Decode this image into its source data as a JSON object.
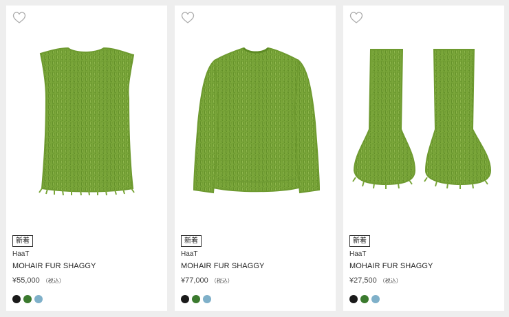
{
  "products": [
    {
      "badge": "新着",
      "brand": "HaaT",
      "name": "MOHAIR FUR SHAGGY",
      "price": "¥55,000",
      "tax_note": "（税込）",
      "image": "green-shaggy-vest",
      "favorite_icon": "heart-outline-icon",
      "colors": [
        "#1a1a1a",
        "#3b7a2e",
        "#7fb0c9"
      ]
    },
    {
      "badge": "新着",
      "brand": "HaaT",
      "name": "MOHAIR FUR SHAGGY",
      "price": "¥77,000",
      "tax_note": "（税込）",
      "image": "green-shaggy-sweater",
      "favorite_icon": "heart-outline-icon",
      "colors": [
        "#1a1a1a",
        "#3b7a2e",
        "#7fb0c9"
      ]
    },
    {
      "badge": "新着",
      "brand": "HaaT",
      "name": "MOHAIR FUR SHAGGY",
      "price": "¥27,500",
      "tax_note": "（税込）",
      "image": "green-shaggy-leg-warmers",
      "favorite_icon": "heart-outline-icon",
      "colors": [
        "#1a1a1a",
        "#3b7a2e",
        "#7fb0c9"
      ]
    }
  ],
  "colors": {
    "product_green": "#7aa63a",
    "product_green_dark": "#5d8a24",
    "product_green_light": "#9cc25a"
  }
}
